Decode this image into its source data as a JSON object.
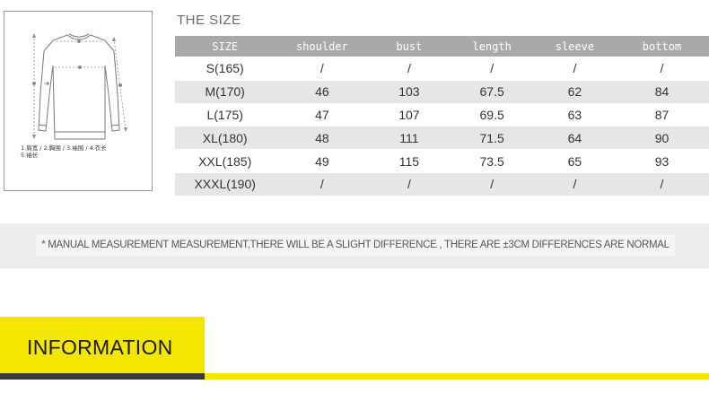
{
  "diagram": {
    "legend_line1": "1.肩宽 / 2.胸围 / 3.袖围 / 4.衣长",
    "legend_line2": "5.袖长"
  },
  "size_chart": {
    "title": "THE SIZE",
    "headers": [
      "SIZE",
      "shoulder",
      "bust",
      "length",
      "sleeve",
      "bottom"
    ],
    "rows": [
      [
        "S(165)",
        "/",
        "/",
        "/",
        "/",
        "/"
      ],
      [
        "M(170)",
        "46",
        "103",
        "67.5",
        "62",
        "84"
      ],
      [
        "L(175)",
        "47",
        "107",
        "69.5",
        "63",
        "87"
      ],
      [
        "XL(180)",
        "48",
        "111",
        "71.5",
        "64",
        "90"
      ],
      [
        "XXL(185)",
        "49",
        "115",
        "73.5",
        "65",
        "93"
      ],
      [
        "XXXL(190)",
        "/",
        "/",
        "/",
        "/",
        "/"
      ]
    ]
  },
  "note": "* MANUAL MEASUREMENT MEASUREMENT,THERE WILL BE A SLIGHT DIFFERENCE , THERE ARE ±3CM DIFFERENCES ARE NORMAL",
  "information": {
    "label": "INFORMATION"
  },
  "colors": {
    "accent_yellow": "#f3e600",
    "header_gray": "#a9a9a9",
    "stripe_gray": "#e6e6e6"
  }
}
